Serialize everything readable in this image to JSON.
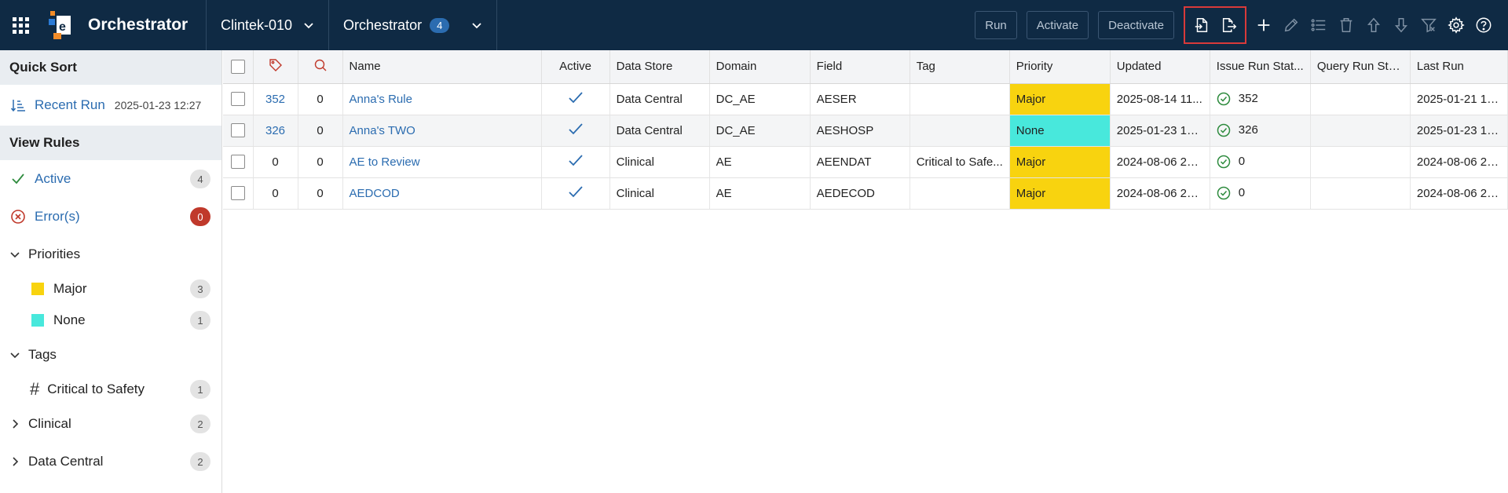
{
  "topbar": {
    "app_title": "Orchestrator",
    "study_select": "Clintek-010",
    "module_select": "Orchestrator",
    "module_badge": "4",
    "buttons": {
      "run": "Run",
      "activate": "Activate",
      "deactivate": "Deactivate"
    },
    "icons": [
      "import-icon",
      "export-icon",
      "add-icon",
      "edit-icon",
      "list-icon",
      "delete-icon",
      "move-up-icon",
      "move-down-icon",
      "filter-icon",
      "settings-icon",
      "help-icon"
    ]
  },
  "sidebar": {
    "quick_sort_header": "Quick Sort",
    "recent_run": {
      "label": "Recent Run",
      "date": "2025-01-23 12:27"
    },
    "view_rules_header": "View Rules",
    "active": {
      "label": "Active",
      "count": "4"
    },
    "errors": {
      "label": "Error(s)",
      "count": "0"
    },
    "priorities": {
      "label": "Priorities",
      "items": [
        {
          "label": "Major",
          "count": "3",
          "color": "#f8d30f"
        },
        {
          "label": "None",
          "count": "1",
          "color": "#48e8dc"
        }
      ]
    },
    "tags": {
      "label": "Tags",
      "items": [
        {
          "label": "Critical to Safety",
          "count": "1"
        }
      ]
    },
    "groups": [
      {
        "label": "Clinical",
        "count": "2"
      },
      {
        "label": "Data Central",
        "count": "2"
      }
    ]
  },
  "table": {
    "columns": [
      "Name",
      "Active",
      "Data Store",
      "Domain",
      "Field",
      "Tag",
      "Priority",
      "Updated",
      "Issue Run Stat...",
      "Query Run Sta...",
      "Last Run"
    ],
    "rows": [
      {
        "issues": "352",
        "queries": "0",
        "name": "Anna's Rule",
        "data_store": "Data Central",
        "domain": "DC_AE",
        "field": "AESER",
        "tag": "",
        "priority": "Major",
        "updated": "2025-08-14 11...",
        "issue_run": "352",
        "query_run": "",
        "last_run": "2025-01-21 15..."
      },
      {
        "issues": "326",
        "queries": "0",
        "name": "Anna's TWO",
        "data_store": "Data Central",
        "domain": "DC_AE",
        "field": "AESHOSP",
        "tag": "",
        "priority": "None",
        "updated": "2025-01-23 12...",
        "issue_run": "326",
        "query_run": "",
        "last_run": "2025-01-23 12..."
      },
      {
        "issues": "0",
        "queries": "0",
        "name": "AE to Review",
        "data_store": "Clinical",
        "domain": "AE",
        "field": "AEENDAT",
        "tag": "Critical to Safe...",
        "priority": "Major",
        "updated": "2024-08-06 23...",
        "issue_run": "0",
        "query_run": "",
        "last_run": "2024-08-06 23..."
      },
      {
        "issues": "0",
        "queries": "0",
        "name": "AEDCOD",
        "data_store": "Clinical",
        "domain": "AE",
        "field": "AEDECOD",
        "tag": "",
        "priority": "Major",
        "updated": "2024-08-06 23...",
        "issue_run": "0",
        "query_run": "",
        "last_run": "2024-08-06 23..."
      }
    ]
  },
  "colors": {
    "topbar": "#0f2a44",
    "link": "#2b6cb0",
    "major": "#f8d30f",
    "none": "#48e8dc",
    "error": "#c0392b",
    "highlight": "#d93a3a"
  }
}
